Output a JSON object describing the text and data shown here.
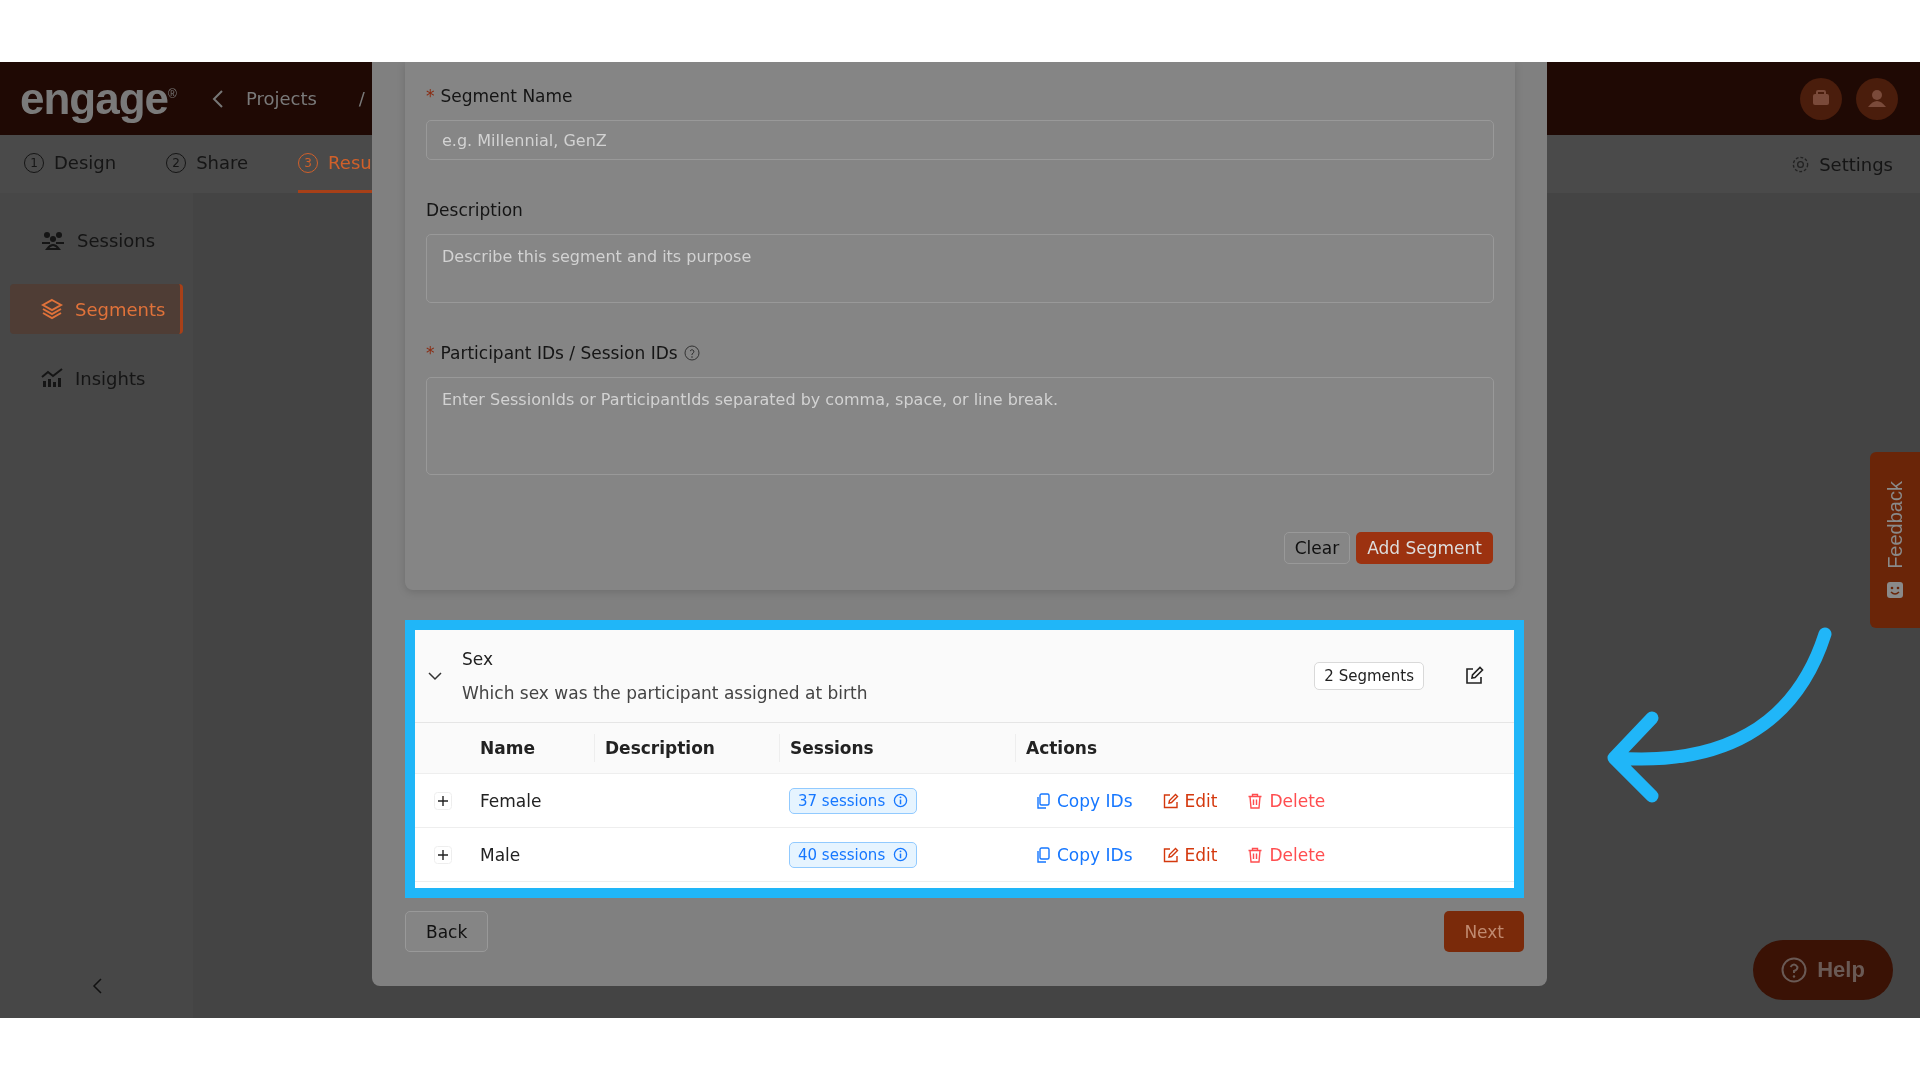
{
  "header": {
    "logo": "engage",
    "logo_mark": "®",
    "breadcrumb": [
      "Projects",
      "/"
    ]
  },
  "steps": [
    {
      "number": "1",
      "label": "Design",
      "selected": false
    },
    {
      "number": "2",
      "label": "Share",
      "selected": false
    },
    {
      "number": "3",
      "label": "Resu",
      "selected": true
    }
  ],
  "settings": "Settings",
  "sidebar": {
    "items": [
      {
        "label": "Sessions",
        "selected": false
      },
      {
        "label": "Segments",
        "selected": true
      },
      {
        "label": "Insights",
        "selected": false
      }
    ]
  },
  "modal": {
    "fields": [
      {
        "kind": "input",
        "required_mark": "*",
        "label": "Segment Name",
        "placeholder": "e.g. Millennial, GenZ"
      },
      {
        "kind": "textarea",
        "label": "Description",
        "placeholder": "Describe this segment and its purpose"
      },
      {
        "kind": "textarea_tall",
        "required_mark": "*",
        "label": "Participant IDs / Session IDs",
        "help": true,
        "placeholder": "Enter SessionIds or ParticipantIds separated by comma, space, or line break."
      }
    ],
    "buttons": [
      {
        "kind": "secondary",
        "label": "Clear"
      },
      {
        "kind": "primary",
        "label": "Add Segment"
      }
    ],
    "group": {
      "expanded": true,
      "title": "Sex",
      "question": "Which sex was the participant assigned at birth",
      "count": "2 Segments",
      "columns": [
        "Name",
        "Description",
        "Sessions",
        "Actions"
      ],
      "rows": [
        {
          "expanded": false,
          "name": "Female",
          "sessions": "37 sessions",
          "actions": [
            {
              "kind": "copy",
              "label": "Copy IDs"
            },
            {
              "kind": "edit",
              "label": "Edit"
            },
            {
              "kind": "delete",
              "label": "Delete"
            }
          ]
        },
        {
          "expanded": false,
          "name": "Male",
          "sessions": "40 sessions",
          "actions": [
            {
              "kind": "copy",
              "label": "Copy IDs"
            },
            {
              "kind": "edit",
              "label": "Edit"
            },
            {
              "kind": "delete",
              "label": "Delete"
            }
          ]
        }
      ]
    },
    "back": "Back",
    "next": "Next"
  },
  "feedback": "Feedback",
  "help": "Help"
}
